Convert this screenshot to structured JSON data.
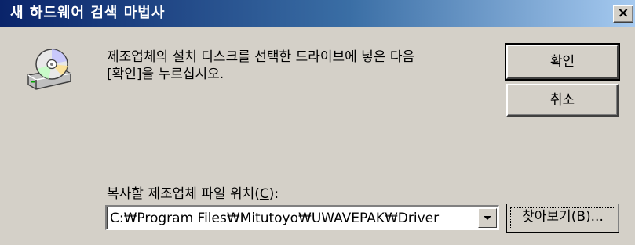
{
  "window": {
    "title": "새 하드웨어 검색 마법사",
    "close_label": "×"
  },
  "icons": {
    "device": "cd-drive-icon",
    "close": "close-icon",
    "dropdown": "chevron-down-icon"
  },
  "message": {
    "line1": "제조업체의 설치 디스크를 선택한 드라이브에 넣은 다음",
    "line2": "[확인]을 누르십시오."
  },
  "buttons": {
    "ok_label": "확인",
    "cancel_label": "취소",
    "browse_prefix": "찾아보기(",
    "browse_accel": "B",
    "browse_suffix": ")..."
  },
  "location": {
    "label_prefix": "복사할 제조업체 파일 위치(",
    "label_accel": "C",
    "label_suffix": "):",
    "value": "C:₩Program Files₩Mitutoyo₩UWAVEPAK₩Driver"
  },
  "colors": {
    "title_start": "#0a246a",
    "title_end": "#a6caf0",
    "face": "#d4d0c8"
  }
}
